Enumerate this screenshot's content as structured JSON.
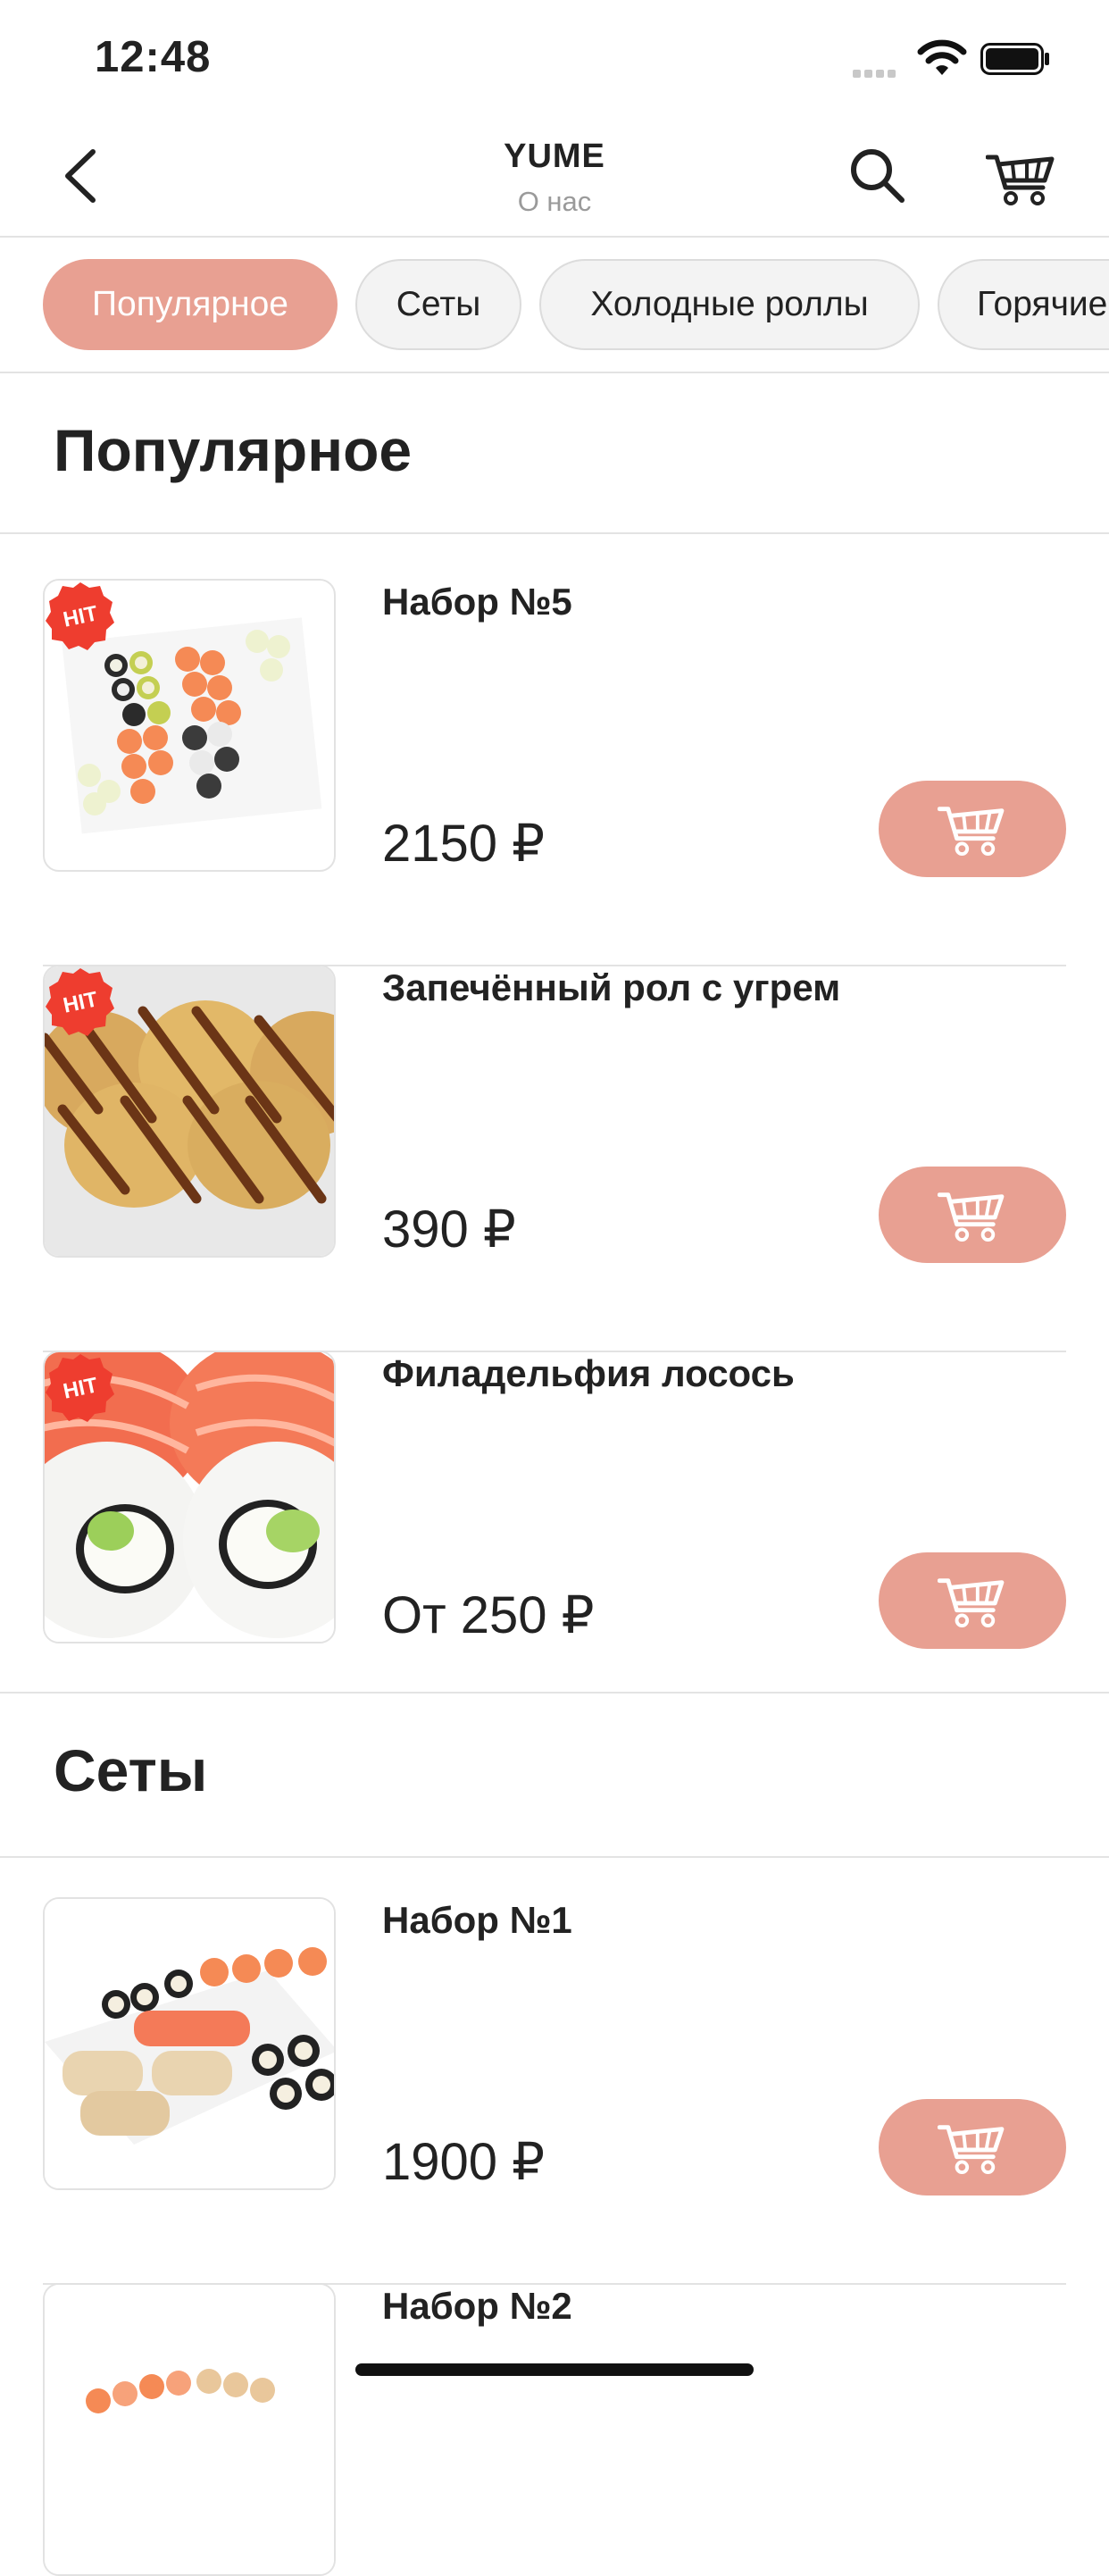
{
  "status_bar": {
    "time": "12:48"
  },
  "nav": {
    "title": "YUME",
    "subtitle": "О нас"
  },
  "tabs": [
    {
      "label": "Популярное",
      "active": true
    },
    {
      "label": "Сеты",
      "active": false
    },
    {
      "label": "Холодные роллы",
      "active": false
    },
    {
      "label": "Горячие",
      "active": false
    }
  ],
  "sections": [
    {
      "title": "Популярное",
      "products": [
        {
          "name": "Набор №5",
          "price": "2150 ₽",
          "badge": "HIT",
          "image_icon": "sushi-set-icon"
        },
        {
          "name": "Запечённый рол с угрем",
          "price": "390 ₽",
          "badge": "HIT",
          "image_icon": "baked-roll-icon"
        },
        {
          "name": "Филадельфия лосось",
          "price": "От 250 ₽",
          "badge": "HIT",
          "image_icon": "philadelphia-roll-icon"
        }
      ]
    },
    {
      "title": "Сеты",
      "products": [
        {
          "name": "Набор №1",
          "price": "1900 ₽",
          "image_icon": "sushi-set-icon"
        },
        {
          "name": "Набор №2",
          "image_icon": "sushi-set-icon"
        }
      ]
    }
  ],
  "colors": {
    "accent": "#e8a092",
    "badge": "#ee3d2f",
    "divider": "#e3e3e3"
  }
}
